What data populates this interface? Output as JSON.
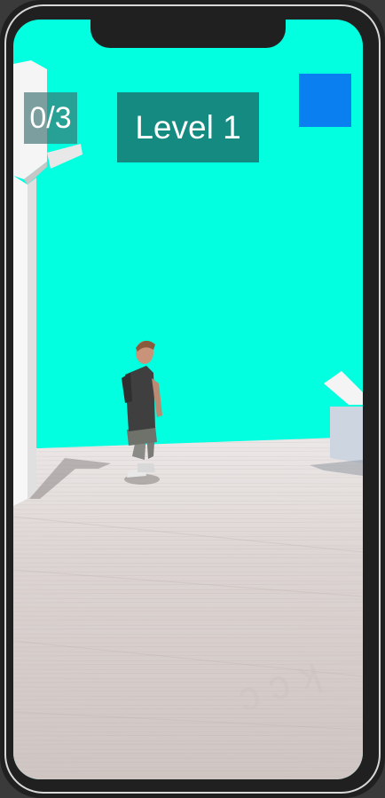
{
  "hud": {
    "collected_counter": "0/3",
    "level_label": "Level 1"
  },
  "colors": {
    "sky": "#02ffe0",
    "floor": "#d9d2d0",
    "pause_button": "#0a7ff0",
    "level_panel": "#148a80",
    "frame": "#202020"
  },
  "icons": {
    "pause_button": "blue-square-icon"
  }
}
